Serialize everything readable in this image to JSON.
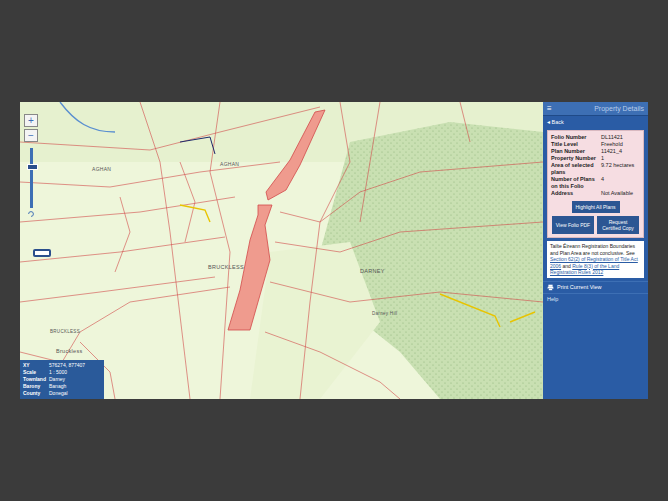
{
  "map": {
    "zoom": {
      "plus": "+",
      "minus": "−",
      "level": 0.72
    },
    "labels": [
      {
        "text": "AGHAN"
      },
      {
        "text": "AGHAN"
      },
      {
        "text": "BRUCKLESS"
      },
      {
        "text": "DARNEY"
      },
      {
        "text": "BRUCKLESS"
      },
      {
        "text": "Bruckless"
      },
      {
        "text": "Darney Hill"
      }
    ],
    "info": [
      {
        "label": "XY",
        "value": "576274, 877407"
      },
      {
        "label": "Scale",
        "value": "1 : 5000"
      },
      {
        "label": "Townland",
        "value": "Darney"
      },
      {
        "label": "Barony",
        "value": "Banagh"
      },
      {
        "label": "County",
        "value": "Donegal"
      }
    ]
  },
  "panel": {
    "menu": "≡",
    "title": "Property Details",
    "back": {
      "icon": "◂",
      "label": "Back"
    },
    "details": [
      {
        "label": "Folio Number",
        "value": "DL11421"
      },
      {
        "label": "Title Level",
        "value": "Freehold"
      },
      {
        "label": "Plan Number",
        "value": "11421_4"
      },
      {
        "label": "Property Number",
        "value": "1"
      },
      {
        "label": "Area of selected plans",
        "value": "9.72 hectares"
      },
      {
        "label": "Number of Plans on this Folio",
        "value": "4"
      },
      {
        "label": "Address",
        "value": "Not Available"
      }
    ],
    "buttons": [
      "Highlight All Plans",
      "View Folio PDF",
      "Request Certified Copy"
    ],
    "notice": [
      {
        "text": "Tailte Éireann Registration Boundaries and Plan Area are not conclusive. See ",
        "link": false
      },
      {
        "text": "Section 62(2) of Registration of Title Act 2006",
        "link": true
      },
      {
        "text": " and ",
        "link": false
      },
      {
        "text": "Rule 8(3) of the Land Registration Rules 2012",
        "link": true
      }
    ],
    "print": "Print Current View",
    "help": "Help"
  }
}
